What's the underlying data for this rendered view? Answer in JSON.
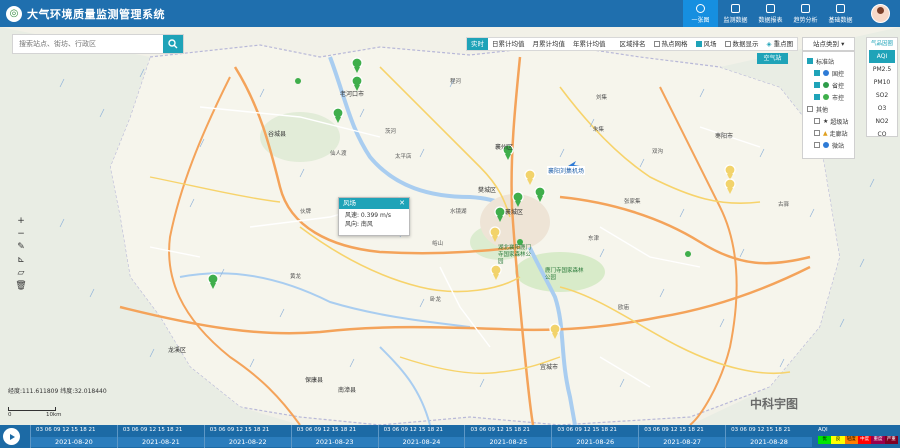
{
  "header": {
    "title": "大气环境质量监测管理系统",
    "nav": [
      {
        "label": "一张图",
        "active": true
      },
      {
        "label": "监测数据",
        "active": false
      },
      {
        "label": "数据报表",
        "active": false
      },
      {
        "label": "趋势分析",
        "active": false
      },
      {
        "label": "基础数据",
        "active": false
      }
    ]
  },
  "search": {
    "placeholder": "搜索站点、街坊、行政区"
  },
  "toolbar": {
    "items": [
      "实时",
      "日累计均值",
      "月累计均值",
      "年累计均值"
    ],
    "active_index": 0,
    "labels": {
      "region_rank": "区域排名",
      "heat": "热点网格",
      "wind": "风场",
      "data_show": "数据显示",
      "heavy": "重点图"
    }
  },
  "air_station_tag": "空气站",
  "station_panel": {
    "dropdown": "站点类别",
    "items": [
      {
        "label": "标准站",
        "checked": true,
        "indent": false,
        "color": ""
      },
      {
        "label": "国控",
        "checked": true,
        "indent": true,
        "color": "#2e7bd6"
      },
      {
        "label": "省控",
        "checked": true,
        "indent": true,
        "color": "#2e9c4a"
      },
      {
        "label": "市控",
        "checked": true,
        "indent": true,
        "color": "#3fb04b"
      },
      {
        "label": "其他",
        "checked": false,
        "indent": false,
        "color": ""
      },
      {
        "label": "超级站",
        "checked": false,
        "indent": true,
        "color": "#444"
      },
      {
        "label": "走廊站",
        "checked": false,
        "indent": true,
        "color": "#e0a020"
      },
      {
        "label": "微站",
        "checked": false,
        "indent": true,
        "color": "#2e7bd6"
      }
    ]
  },
  "pollutant_panel": {
    "header": "气品因圈",
    "items": [
      "AQI",
      "PM2.5",
      "PM10",
      "SO2",
      "O3",
      "NO2",
      "CO"
    ],
    "active_index": 0
  },
  "popup": {
    "title": "风场",
    "speed_label": "风速: 0.399 m/s",
    "direction_label": "风向: 南风"
  },
  "coords": "经度:111.611809 纬度:32.018440",
  "scale": {
    "zero": "0",
    "value": "10km"
  },
  "watermark": "中科宇图",
  "timeline": {
    "hours": "03 06 09 12 15 18 21",
    "dates": [
      "2021-08-20",
      "2021-08-21",
      "2021-08-22",
      "2021-08-23",
      "2021-08-24",
      "2021-08-25",
      "2021-08-26",
      "2021-08-27",
      "2021-08-28"
    ],
    "progress": 0.0
  },
  "legend": {
    "title": "AQI",
    "levels": [
      {
        "label": "优",
        "color": "#00e400"
      },
      {
        "label": "良",
        "color": "#ffff00"
      },
      {
        "label": "轻度",
        "color": "#ff7e00"
      },
      {
        "label": "中度",
        "color": "#ff0000"
      },
      {
        "label": "重度",
        "color": "#99004c"
      },
      {
        "label": "严重",
        "color": "#7e0023"
      }
    ]
  },
  "map_labels": [
    "龙溪区",
    "湖北襄阳鹿门寺国家森林公园",
    "鹿门寺国家森林公园",
    "保康县",
    "南漳县",
    "宜城市",
    "枣阳市",
    "谷城县",
    "老河口市",
    "襄州区",
    "樊城区",
    "襄城区",
    "襄阳刘集机场",
    "水镜湖",
    "峪山",
    "东津",
    "双沟",
    "张家集",
    "黄龙",
    "太平店",
    "茨河",
    "仙人渡",
    "伙牌",
    "朱集",
    "程河",
    "古驿",
    "刘集",
    "卧龙",
    "欧庙"
  ]
}
